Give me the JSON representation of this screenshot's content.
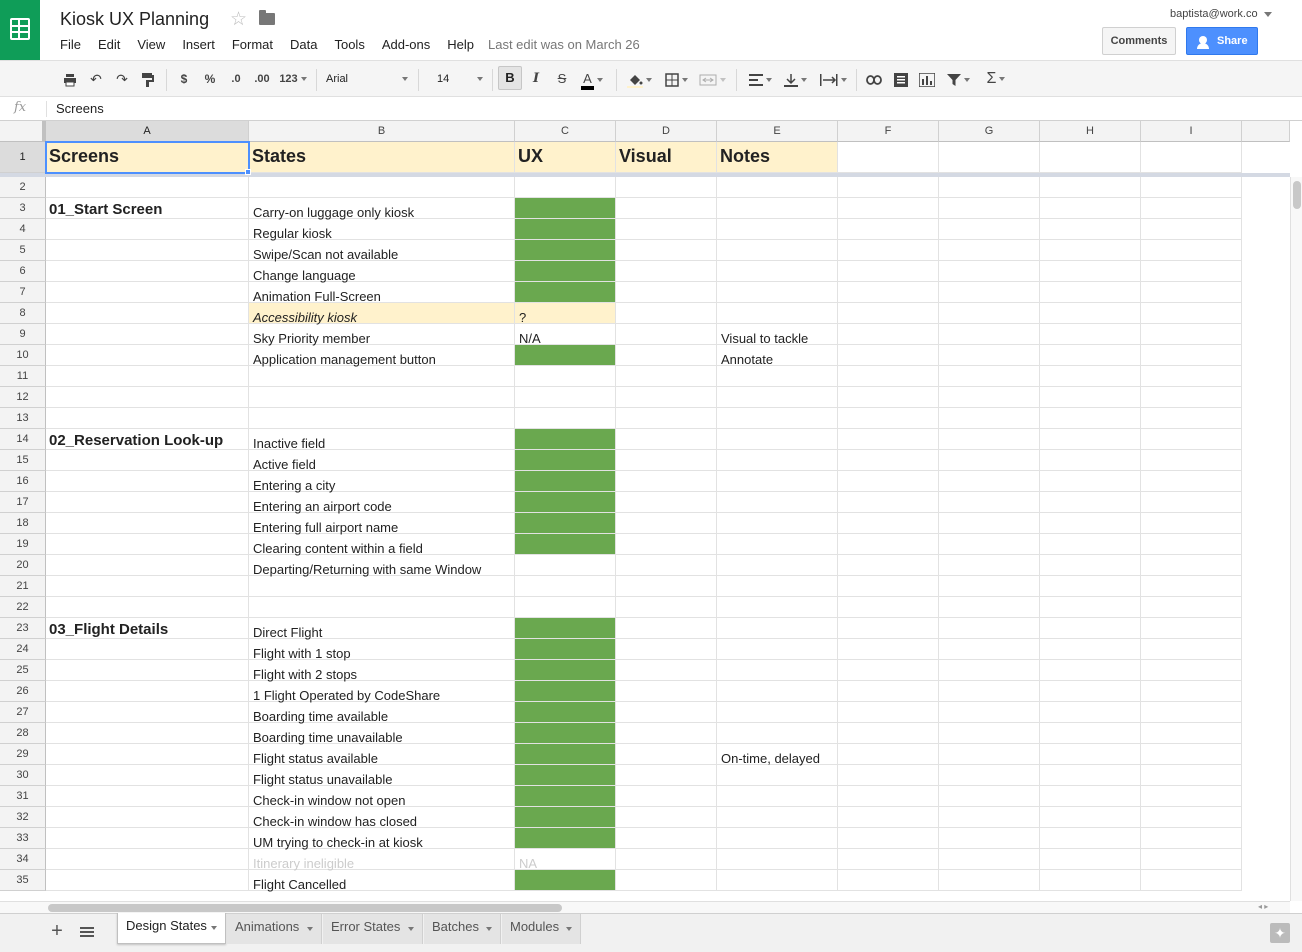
{
  "app": {
    "title": "Kiosk UX Planning",
    "user": "baptista@work.co",
    "last_edit": "Last edit was on March 26",
    "comments_label": "Comments",
    "share_label": "Share",
    "menus": [
      "File",
      "Edit",
      "View",
      "Insert",
      "Format",
      "Data",
      "Tools",
      "Add-ons",
      "Help"
    ]
  },
  "toolbar": {
    "currency": "$",
    "percent": "%",
    "dec_decrease": ".0",
    "dec_increase": ".00",
    "more_formats": "123",
    "font": "Arial",
    "font_size": "14",
    "bold": "B",
    "italic": "I",
    "strike": "S",
    "text_color": "A",
    "sum": "Σ"
  },
  "formula_bar": {
    "fx": "fx",
    "value": "Screens"
  },
  "columns": [
    "A",
    "B",
    "C",
    "D",
    "E",
    "F",
    "G",
    "H",
    "I"
  ],
  "header_row": {
    "A": "Screens",
    "B": "States",
    "C": "UX",
    "D": "Visual",
    "E": "Notes"
  },
  "rows": [
    {
      "n": "1"
    },
    {
      "n": "2"
    },
    {
      "n": "3",
      "A": "01_Start Screen",
      "B": "Carry-on luggage only kiosk",
      "C_fill": "green"
    },
    {
      "n": "4",
      "B": "Regular kiosk",
      "C_fill": "green"
    },
    {
      "n": "5",
      "B": "Swipe/Scan not available",
      "C_fill": "green"
    },
    {
      "n": "6",
      "B": "Change language",
      "C_fill": "green"
    },
    {
      "n": "7",
      "B": "Animation Full-Screen",
      "C_fill": "green"
    },
    {
      "n": "8",
      "B": "Accessibility kiosk",
      "C": "?",
      "style": "highlight"
    },
    {
      "n": "9",
      "B": "Sky Priority member",
      "C": "N/A",
      "E": "Visual to tackle"
    },
    {
      "n": "10",
      "B": "Application management button",
      "C_fill": "green",
      "E": "Annotate"
    },
    {
      "n": "11"
    },
    {
      "n": "12"
    },
    {
      "n": "13"
    },
    {
      "n": "14",
      "A": "02_Reservation Look-up",
      "B": "Inactive field",
      "C_fill": "green"
    },
    {
      "n": "15",
      "B": "Active field",
      "C_fill": "green"
    },
    {
      "n": "16",
      "B": "Entering a city",
      "C_fill": "green"
    },
    {
      "n": "17",
      "B": "Entering an airport code",
      "C_fill": "green"
    },
    {
      "n": "18",
      "B": "Entering full airport name",
      "C_fill": "green"
    },
    {
      "n": "19",
      "B": "Clearing content within a field",
      "C_fill": "green"
    },
    {
      "n": "20",
      "B": "Departing/Returning with same Window"
    },
    {
      "n": "21"
    },
    {
      "n": "22"
    },
    {
      "n": "23",
      "A": "03_Flight Details",
      "B": "Direct Flight",
      "C_fill": "green"
    },
    {
      "n": "24",
      "B": "Flight with 1 stop",
      "C_fill": "green"
    },
    {
      "n": "25",
      "B": "Flight with 2 stops",
      "C_fill": "green"
    },
    {
      "n": "26",
      "B": "1 Flight Operated by CodeShare",
      "C_fill": "green"
    },
    {
      "n": "27",
      "B": "Boarding time available",
      "C_fill": "green"
    },
    {
      "n": "28",
      "B": "Boarding time unavailable",
      "C_fill": "green"
    },
    {
      "n": "29",
      "B": "Flight status available",
      "C_fill": "green",
      "E": "On-time, delayed"
    },
    {
      "n": "30",
      "B": "Flight status unavailable",
      "C_fill": "green"
    },
    {
      "n": "31",
      "B": "Check-in window not open",
      "C_fill": "green"
    },
    {
      "n": "32",
      "B": "Check-in window has closed",
      "C_fill": "green"
    },
    {
      "n": "33",
      "B": "UM trying to check-in at kiosk",
      "C_fill": "green"
    },
    {
      "n": "34",
      "B": "Itinerary ineligible",
      "C": "NA",
      "style": "greyed"
    },
    {
      "n": "35",
      "B": "Flight Cancelled",
      "C_fill": "green"
    }
  ],
  "colors": {
    "green_fill": "#6aa84f",
    "header_fill": "#fff2cc",
    "brand": "#0f9d58",
    "share_blue": "#4d90fe"
  },
  "sheet_tabs": [
    "Design States",
    "Animations",
    "Error States",
    "Batches",
    "Modules"
  ],
  "active_tab": "Design States"
}
